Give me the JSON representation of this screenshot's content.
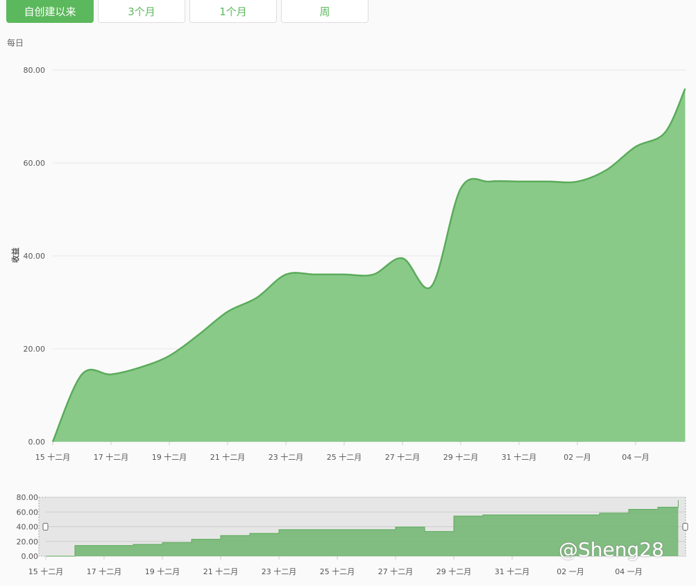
{
  "range_buttons": [
    {
      "label": "自创建以来",
      "active": true
    },
    {
      "label": "3个月"
    },
    {
      "label": "1个月"
    },
    {
      "label": "周"
    }
  ],
  "period_label": "每日",
  "watermark": "@Sheng28",
  "chart_data": {
    "type": "area",
    "ylabel": "收益",
    "ylim": [
      0,
      80
    ],
    "yticks": [
      "0.00",
      "20.00",
      "40.00",
      "60.00",
      "80.00"
    ],
    "ytick_values": [
      0,
      20,
      40,
      60,
      80
    ],
    "xtick_labels": [
      "15 十二月",
      "17 十二月",
      "19 十二月",
      "21 十二月",
      "23 十二月",
      "25 十二月",
      "27 十二月",
      "29 十二月",
      "31 十二月",
      "02 一月",
      "04 一月"
    ],
    "xtick_days": [
      0,
      2,
      4,
      6,
      8,
      10,
      12,
      14,
      16,
      18,
      20
    ],
    "x_days": [
      0,
      1,
      2,
      3,
      4,
      5,
      6,
      7,
      8,
      9,
      10,
      11,
      12,
      13,
      14,
      15,
      16,
      17,
      18,
      19,
      20,
      21,
      21.7
    ],
    "values": [
      0,
      14.5,
      14.5,
      16,
      18.5,
      23,
      28,
      31,
      36,
      36,
      36,
      36,
      39.5,
      33.5,
      54.5,
      56,
      56,
      56,
      56,
      58.5,
      63.5,
      66.5,
      76
    ],
    "color": "#5cb85c",
    "navigator": {
      "yticks": [
        "0.00",
        "20.00",
        "40.00",
        "60.00",
        "80.00"
      ]
    }
  }
}
